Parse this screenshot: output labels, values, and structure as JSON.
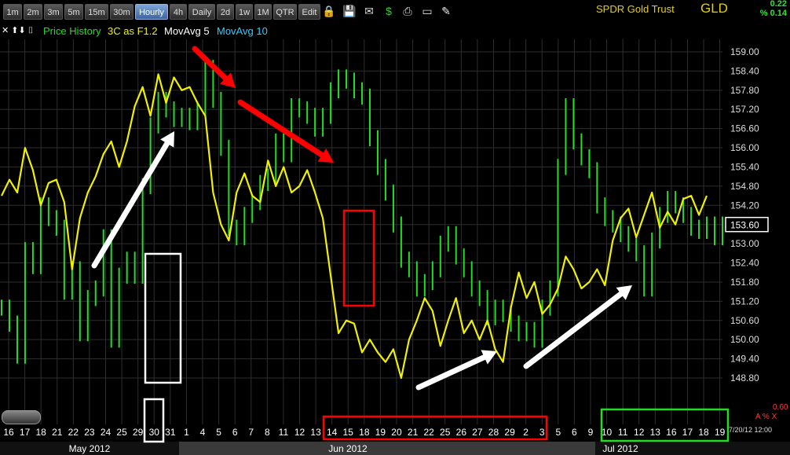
{
  "toolbar": {
    "buttons": [
      "1m",
      "2m",
      "3m",
      "5m",
      "15m",
      "30m",
      "Hourly",
      "4h",
      "Daily",
      "2d",
      "1w",
      "1M",
      "QTR",
      "Edit"
    ],
    "active": "Hourly",
    "icons": [
      "lock-icon",
      "save-icon",
      "email-icon",
      "dollar-icon",
      "print-icon",
      "chart-window-icon",
      "pencil-icon"
    ]
  },
  "header": {
    "title": "SPDR Gold Trust",
    "symbol": "GLD",
    "change_abs": "0.22",
    "change_pct": "% 0.14"
  },
  "legend": {
    "arrows": "✕ ⬆⬇ ⌷",
    "items": [
      {
        "label": "Price History",
        "color": "#22dd22"
      },
      {
        "label": "3C as F1.2",
        "color": "#f0f000"
      },
      {
        "label": "MovAvg 5",
        "color": "#ffffff"
      },
      {
        "label": "MovAvg 10",
        "color": "#33ccff"
      }
    ]
  },
  "readouts": {
    "lower_value": "0.60",
    "lower_markers": "A % X",
    "datetime": "7/20/12 12:00"
  },
  "chart_data": {
    "type": "line",
    "y_axis": {
      "range": [
        148.5,
        159.4
      ],
      "ticks": [
        159.0,
        158.4,
        157.8,
        157.2,
        156.6,
        156.0,
        155.4,
        154.8,
        154.2,
        153.6,
        153.0,
        152.4,
        151.8,
        151.2,
        150.6,
        150.0,
        149.4,
        148.8
      ],
      "current_price": 153.6
    },
    "x_axis": {
      "date_ticks": [
        "16",
        "17",
        "18",
        "21",
        "22",
        "23",
        "24",
        "25",
        "29",
        "30",
        "31",
        "1",
        "4",
        "5",
        "6",
        "7",
        "8",
        "11",
        "12",
        "13",
        "14",
        "15",
        "18",
        "19",
        "20",
        "21",
        "22",
        "25",
        "26",
        "27",
        "28",
        "29",
        "2",
        "3",
        "5",
        "6",
        "9",
        "10",
        "11",
        "12",
        "13",
        "16",
        "17",
        "18",
        "19"
      ],
      "months": [
        "May 2012",
        "Jun 2012",
        "Jul 2012"
      ]
    },
    "grid": true,
    "series": [
      {
        "name": "Price History",
        "color": "#22dd22",
        "points": [
          [
            0,
            151.0
          ],
          [
            1,
            150.5
          ],
          [
            2,
            149.5
          ],
          [
            3,
            152.8
          ],
          [
            4,
            152.3
          ],
          [
            5,
            154.2
          ],
          [
            6,
            153.8
          ],
          [
            7,
            153.5
          ],
          [
            8,
            151.5
          ],
          [
            9,
            152.2
          ],
          [
            10,
            150.2
          ],
          [
            11,
            151.3
          ],
          [
            12,
            151.6
          ],
          [
            13,
            153.2
          ],
          [
            14,
            150.0
          ],
          [
            15,
            152.0
          ],
          [
            16,
            152.5
          ],
          [
            17,
            152.0
          ],
          [
            18,
            154.8
          ],
          [
            19,
            156.7
          ],
          [
            20,
            157.5
          ],
          [
            21,
            157.2
          ],
          [
            22,
            156.9
          ],
          [
            23,
            157.0
          ],
          [
            24,
            156.8
          ],
          [
            25,
            157.2
          ],
          [
            26,
            158.5
          ],
          [
            27,
            157.5
          ],
          [
            28,
            156.0
          ],
          [
            29,
            153.5
          ],
          [
            30,
            153.2
          ],
          [
            31,
            153.9
          ],
          [
            32,
            154.3
          ],
          [
            33,
            154.9
          ],
          [
            34,
            155.1
          ],
          [
            35,
            156.2
          ],
          [
            36,
            155.8
          ],
          [
            37,
            157.3
          ],
          [
            38,
            157.2
          ],
          [
            39,
            157.0
          ],
          [
            40,
            156.6
          ],
          [
            41,
            157.0
          ],
          [
            42,
            157.8
          ],
          [
            43,
            158.2
          ],
          [
            44,
            158.1
          ],
          [
            45,
            157.8
          ],
          [
            46,
            157.6
          ],
          [
            47,
            156.3
          ],
          [
            48,
            155.4
          ],
          [
            49,
            154.6
          ],
          [
            50,
            153.6
          ],
          [
            51,
            152.5
          ],
          [
            52,
            152.2
          ],
          [
            53,
            151.6
          ],
          [
            54,
            151.8
          ],
          [
            55,
            152.2
          ],
          [
            56,
            153.0
          ],
          [
            57,
            153.3
          ],
          [
            58,
            152.6
          ],
          [
            59,
            152.2
          ],
          [
            60,
            151.6
          ],
          [
            61,
            151.3
          ],
          [
            62,
            150.7
          ],
          [
            63,
            151.0
          ],
          [
            64,
            150.8
          ],
          [
            65,
            150.5
          ],
          [
            66,
            150.2
          ],
          [
            67,
            150.3
          ],
          [
            68,
            150.0
          ],
          [
            69,
            151.0
          ],
          [
            70,
            151.6
          ],
          [
            71,
            155.4
          ],
          [
            72,
            157.3
          ],
          [
            73,
            156.2
          ],
          [
            74,
            155.7
          ],
          [
            75,
            155.3
          ],
          [
            76,
            154.2
          ],
          [
            77,
            153.8
          ],
          [
            78,
            153.6
          ],
          [
            79,
            153.3
          ],
          [
            80,
            153.0
          ],
          [
            81,
            152.7
          ],
          [
            82,
            151.6
          ],
          [
            83,
            153.1
          ],
          [
            84,
            153.9
          ],
          [
            85,
            154.4
          ],
          [
            86,
            154.2
          ],
          [
            87,
            153.9
          ],
          [
            88,
            153.5
          ],
          [
            89,
            153.4
          ],
          [
            90,
            153.6
          ],
          [
            91,
            153.2
          ],
          [
            92,
            153.6
          ]
        ]
      },
      {
        "name": "3C as F1.2",
        "color": "#f0f000",
        "points": [
          [
            0,
            154.5
          ],
          [
            1,
            155.0
          ],
          [
            2,
            154.6
          ],
          [
            3,
            156.0
          ],
          [
            4,
            155.3
          ],
          [
            5,
            154.2
          ],
          [
            6,
            154.9
          ],
          [
            7,
            155.0
          ],
          [
            8,
            154.3
          ],
          [
            9,
            152.2
          ],
          [
            10,
            153.8
          ],
          [
            11,
            154.6
          ],
          [
            12,
            155.1
          ],
          [
            13,
            155.8
          ],
          [
            14,
            156.2
          ],
          [
            15,
            155.4
          ],
          [
            16,
            156.2
          ],
          [
            17,
            157.3
          ],
          [
            18,
            157.9
          ],
          [
            19,
            157.0
          ],
          [
            20,
            158.3
          ],
          [
            21,
            157.4
          ],
          [
            22,
            158.2
          ],
          [
            23,
            157.8
          ],
          [
            24,
            157.9
          ],
          [
            25,
            157.4
          ],
          [
            26,
            157.0
          ],
          [
            27,
            154.6
          ],
          [
            28,
            153.6
          ],
          [
            29,
            153.1
          ],
          [
            30,
            154.6
          ],
          [
            31,
            155.2
          ],
          [
            32,
            154.5
          ],
          [
            33,
            154.3
          ],
          [
            34,
            155.6
          ],
          [
            35,
            154.8
          ],
          [
            36,
            155.4
          ],
          [
            37,
            154.6
          ],
          [
            38,
            154.8
          ],
          [
            39,
            155.3
          ],
          [
            40,
            154.6
          ],
          [
            41,
            153.8
          ],
          [
            42,
            152.0
          ],
          [
            43,
            150.2
          ],
          [
            44,
            150.6
          ],
          [
            45,
            150.5
          ],
          [
            46,
            149.6
          ],
          [
            47,
            150.0
          ],
          [
            48,
            149.6
          ],
          [
            49,
            149.3
          ],
          [
            50,
            149.7
          ],
          [
            51,
            148.8
          ],
          [
            52,
            150.0
          ],
          [
            53,
            150.6
          ],
          [
            54,
            151.3
          ],
          [
            55,
            150.9
          ],
          [
            56,
            149.8
          ],
          [
            57,
            150.6
          ],
          [
            58,
            151.3
          ],
          [
            59,
            150.2
          ],
          [
            60,
            150.6
          ],
          [
            61,
            150.0
          ],
          [
            62,
            150.6
          ],
          [
            63,
            149.7
          ],
          [
            64,
            149.3
          ],
          [
            65,
            151.0
          ],
          [
            66,
            152.1
          ],
          [
            67,
            151.3
          ],
          [
            68,
            151.8
          ],
          [
            69,
            150.8
          ],
          [
            70,
            151.1
          ],
          [
            71,
            151.6
          ],
          [
            72,
            152.6
          ],
          [
            73,
            152.2
          ],
          [
            74,
            151.6
          ],
          [
            75,
            151.8
          ],
          [
            76,
            152.2
          ],
          [
            77,
            151.7
          ],
          [
            78,
            153.1
          ],
          [
            79,
            153.8
          ],
          [
            80,
            154.1
          ],
          [
            81,
            153.2
          ],
          [
            82,
            153.9
          ],
          [
            83,
            154.6
          ],
          [
            84,
            153.5
          ],
          [
            85,
            154.0
          ],
          [
            86,
            153.6
          ],
          [
            87,
            154.4
          ],
          [
            88,
            154.5
          ],
          [
            89,
            153.9
          ],
          [
            90,
            154.5
          ]
        ]
      }
    ],
    "annotations": [
      {
        "type": "arrow",
        "color": "white",
        "from": [
          23,
          152.3
        ],
        "to": [
          31,
          156.9
        ]
      },
      {
        "type": "arrow",
        "color": "red",
        "from": [
          4,
          159.0
        ],
        "to": [
          6,
          157.6
        ]
      },
      {
        "type": "arrow",
        "color": "red",
        "from": [
          6,
          157.3
        ],
        "to": [
          14,
          155.3
        ]
      },
      {
        "type": "arrow",
        "color": "white",
        "from": [
          21,
          148.6
        ],
        "to": [
          28,
          150.0
        ]
      },
      {
        "type": "arrow",
        "color": "white",
        "from": [
          2,
          149.3
        ],
        "to": [
          12,
          151.8
        ]
      },
      {
        "type": "box",
        "color": "white"
      },
      {
        "type": "box",
        "color": "white"
      },
      {
        "type": "box",
        "color": "red"
      },
      {
        "type": "box",
        "color": "red"
      },
      {
        "type": "box",
        "color": "#22dd22"
      }
    ]
  }
}
